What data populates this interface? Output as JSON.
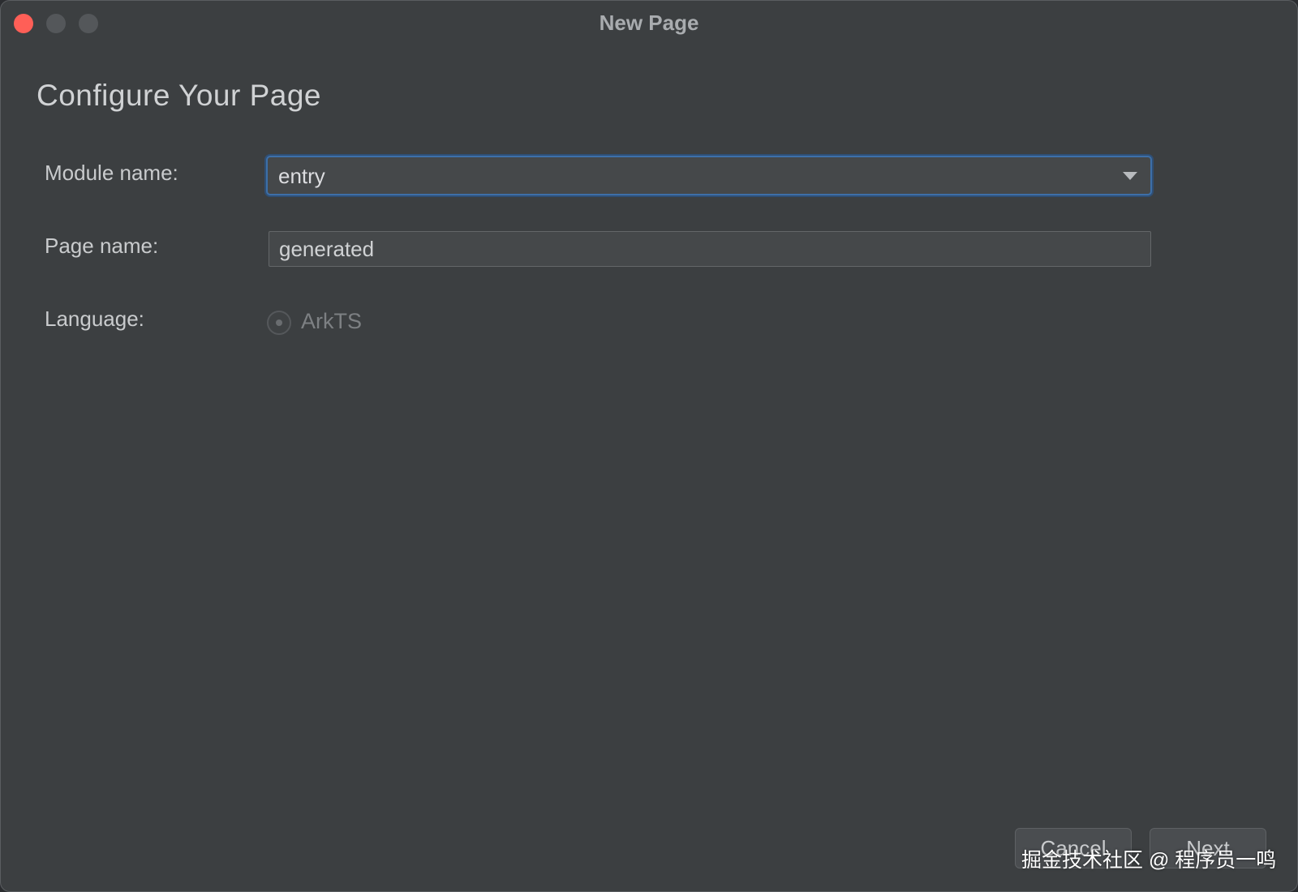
{
  "window": {
    "title": "New Page",
    "controls": [
      "close",
      "minimize",
      "maximize"
    ]
  },
  "page": {
    "heading": "Configure Your Page"
  },
  "form": {
    "module": {
      "label": "Module name:",
      "value": "entry"
    },
    "page_name": {
      "label": "Page name:",
      "value": "generated"
    },
    "language": {
      "label": "Language:",
      "option": "ArkTS",
      "selected": true
    }
  },
  "buttons": {
    "cancel": "Cancel",
    "next": "Next"
  },
  "watermark": "掘金技术社区 @ 程序员一鸣",
  "colors": {
    "background": "#3c3f41",
    "focus_border": "#3d6fa8",
    "close_button": "#ff5f57"
  }
}
